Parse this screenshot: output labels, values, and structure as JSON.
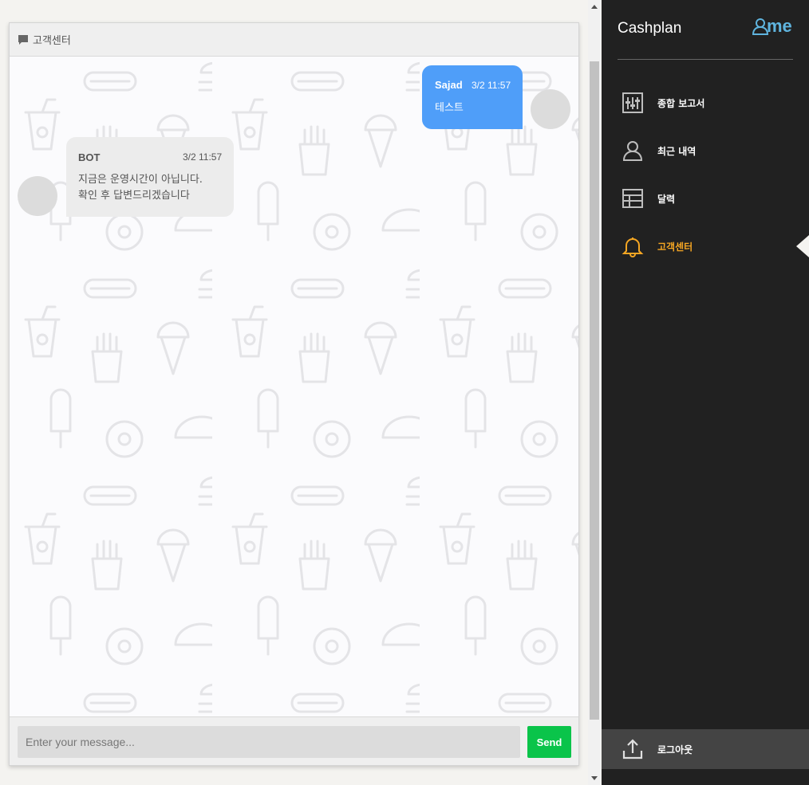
{
  "chat": {
    "header_title": "고객센터",
    "messages": [
      {
        "sender": "Sajad",
        "time": "3/2 11:57",
        "text": "테스트"
      },
      {
        "sender": "BOT",
        "time": "3/2 11:57",
        "line1": "지금은 운영시간이 아닙니다.",
        "line2": "확인 후 답변드리겠습니다"
      }
    ],
    "input_placeholder": "Enter your message...",
    "send_label": "Send"
  },
  "sidebar": {
    "brand": "Cashplan",
    "me_logo": "me",
    "items": [
      {
        "label": "종합 보고서",
        "icon": "report-icon"
      },
      {
        "label": "최근 내역",
        "icon": "user-icon"
      },
      {
        "label": "달력",
        "icon": "calendar-icon"
      },
      {
        "label": "고객센터",
        "icon": "bell-icon",
        "active": true
      }
    ],
    "logout_label": "로그아웃"
  },
  "colors": {
    "user_bubble": "#4f9ef9",
    "bot_bubble": "#ececec",
    "send_button": "#0ac44a",
    "sidebar_bg": "#212121",
    "active_nav": "#f5a623",
    "me_logo": "#5fb4de"
  }
}
